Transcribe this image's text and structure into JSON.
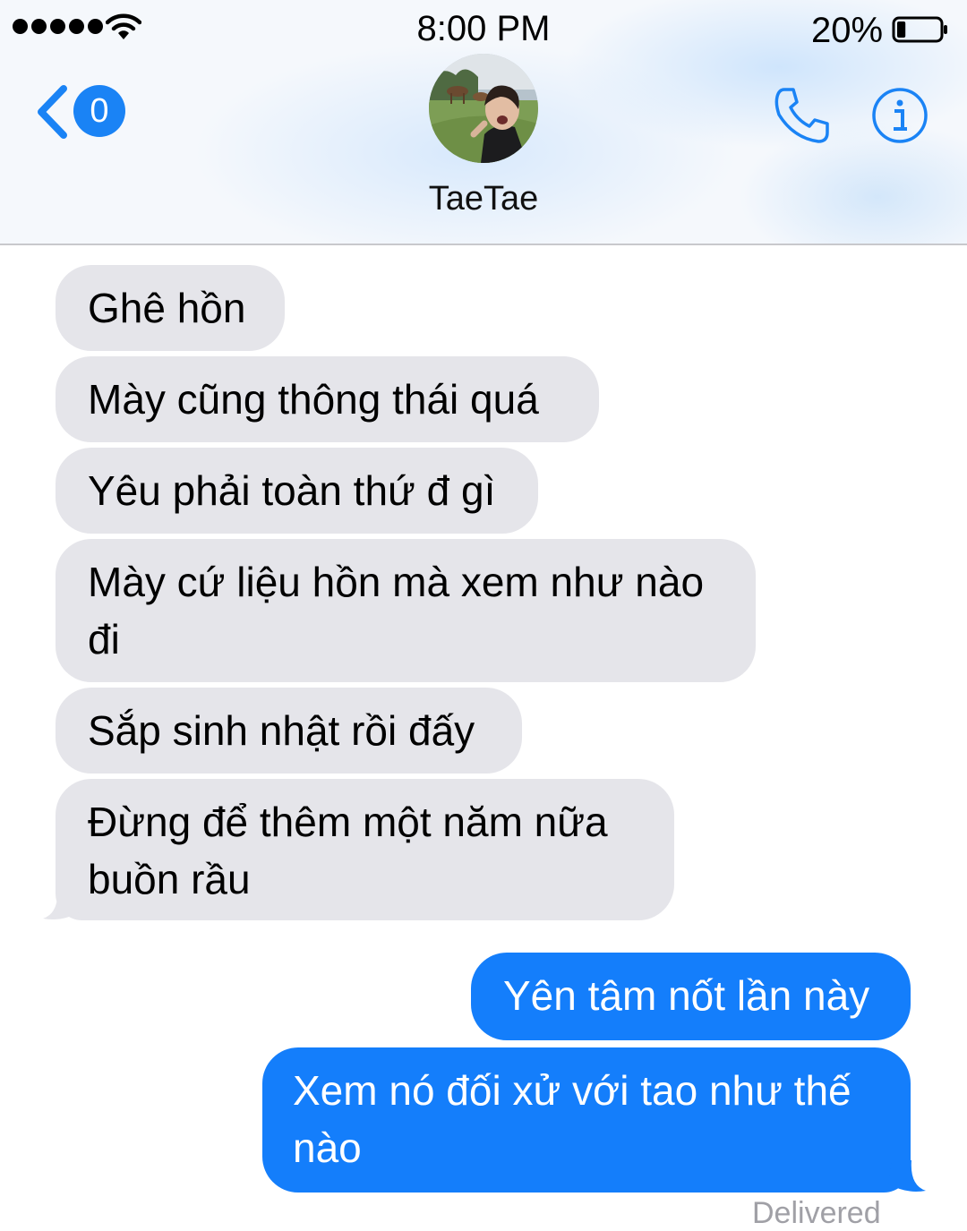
{
  "status_bar": {
    "time": "8:00 PM",
    "battery_percent": "20%",
    "battery_level": 0.2,
    "signal_icon": "signal-dots-icon",
    "wifi_icon": "wifi-icon"
  },
  "header": {
    "back_badge_count": "0",
    "contact_name": "TaeTae",
    "accent_color": "#1a83f5",
    "icons": [
      "chevron-left-icon",
      "phone-icon",
      "info-icon"
    ]
  },
  "messages": [
    {
      "direction": "incoming",
      "text": "Ghê hồn"
    },
    {
      "direction": "incoming",
      "text": "Mày cũng thông thái quá"
    },
    {
      "direction": "incoming",
      "text": "Yêu phải toàn thứ đ gì"
    },
    {
      "direction": "incoming",
      "text": "Mày cứ liệu hồn mà xem như nào đi"
    },
    {
      "direction": "incoming",
      "text": "Sắp sinh nhật rồi đấy"
    },
    {
      "direction": "incoming",
      "text": "Đừng để thêm một năm nữa buồn rầu"
    },
    {
      "direction": "outgoing",
      "text": "Yên tâm nốt lần này"
    },
    {
      "direction": "outgoing",
      "text": "Xem nó đối xử với tao như thế nào"
    }
  ],
  "delivery_status": "Delivered",
  "colors": {
    "incoming_bubble": "#e5e5ea",
    "outgoing_bubble": "#147efb"
  }
}
